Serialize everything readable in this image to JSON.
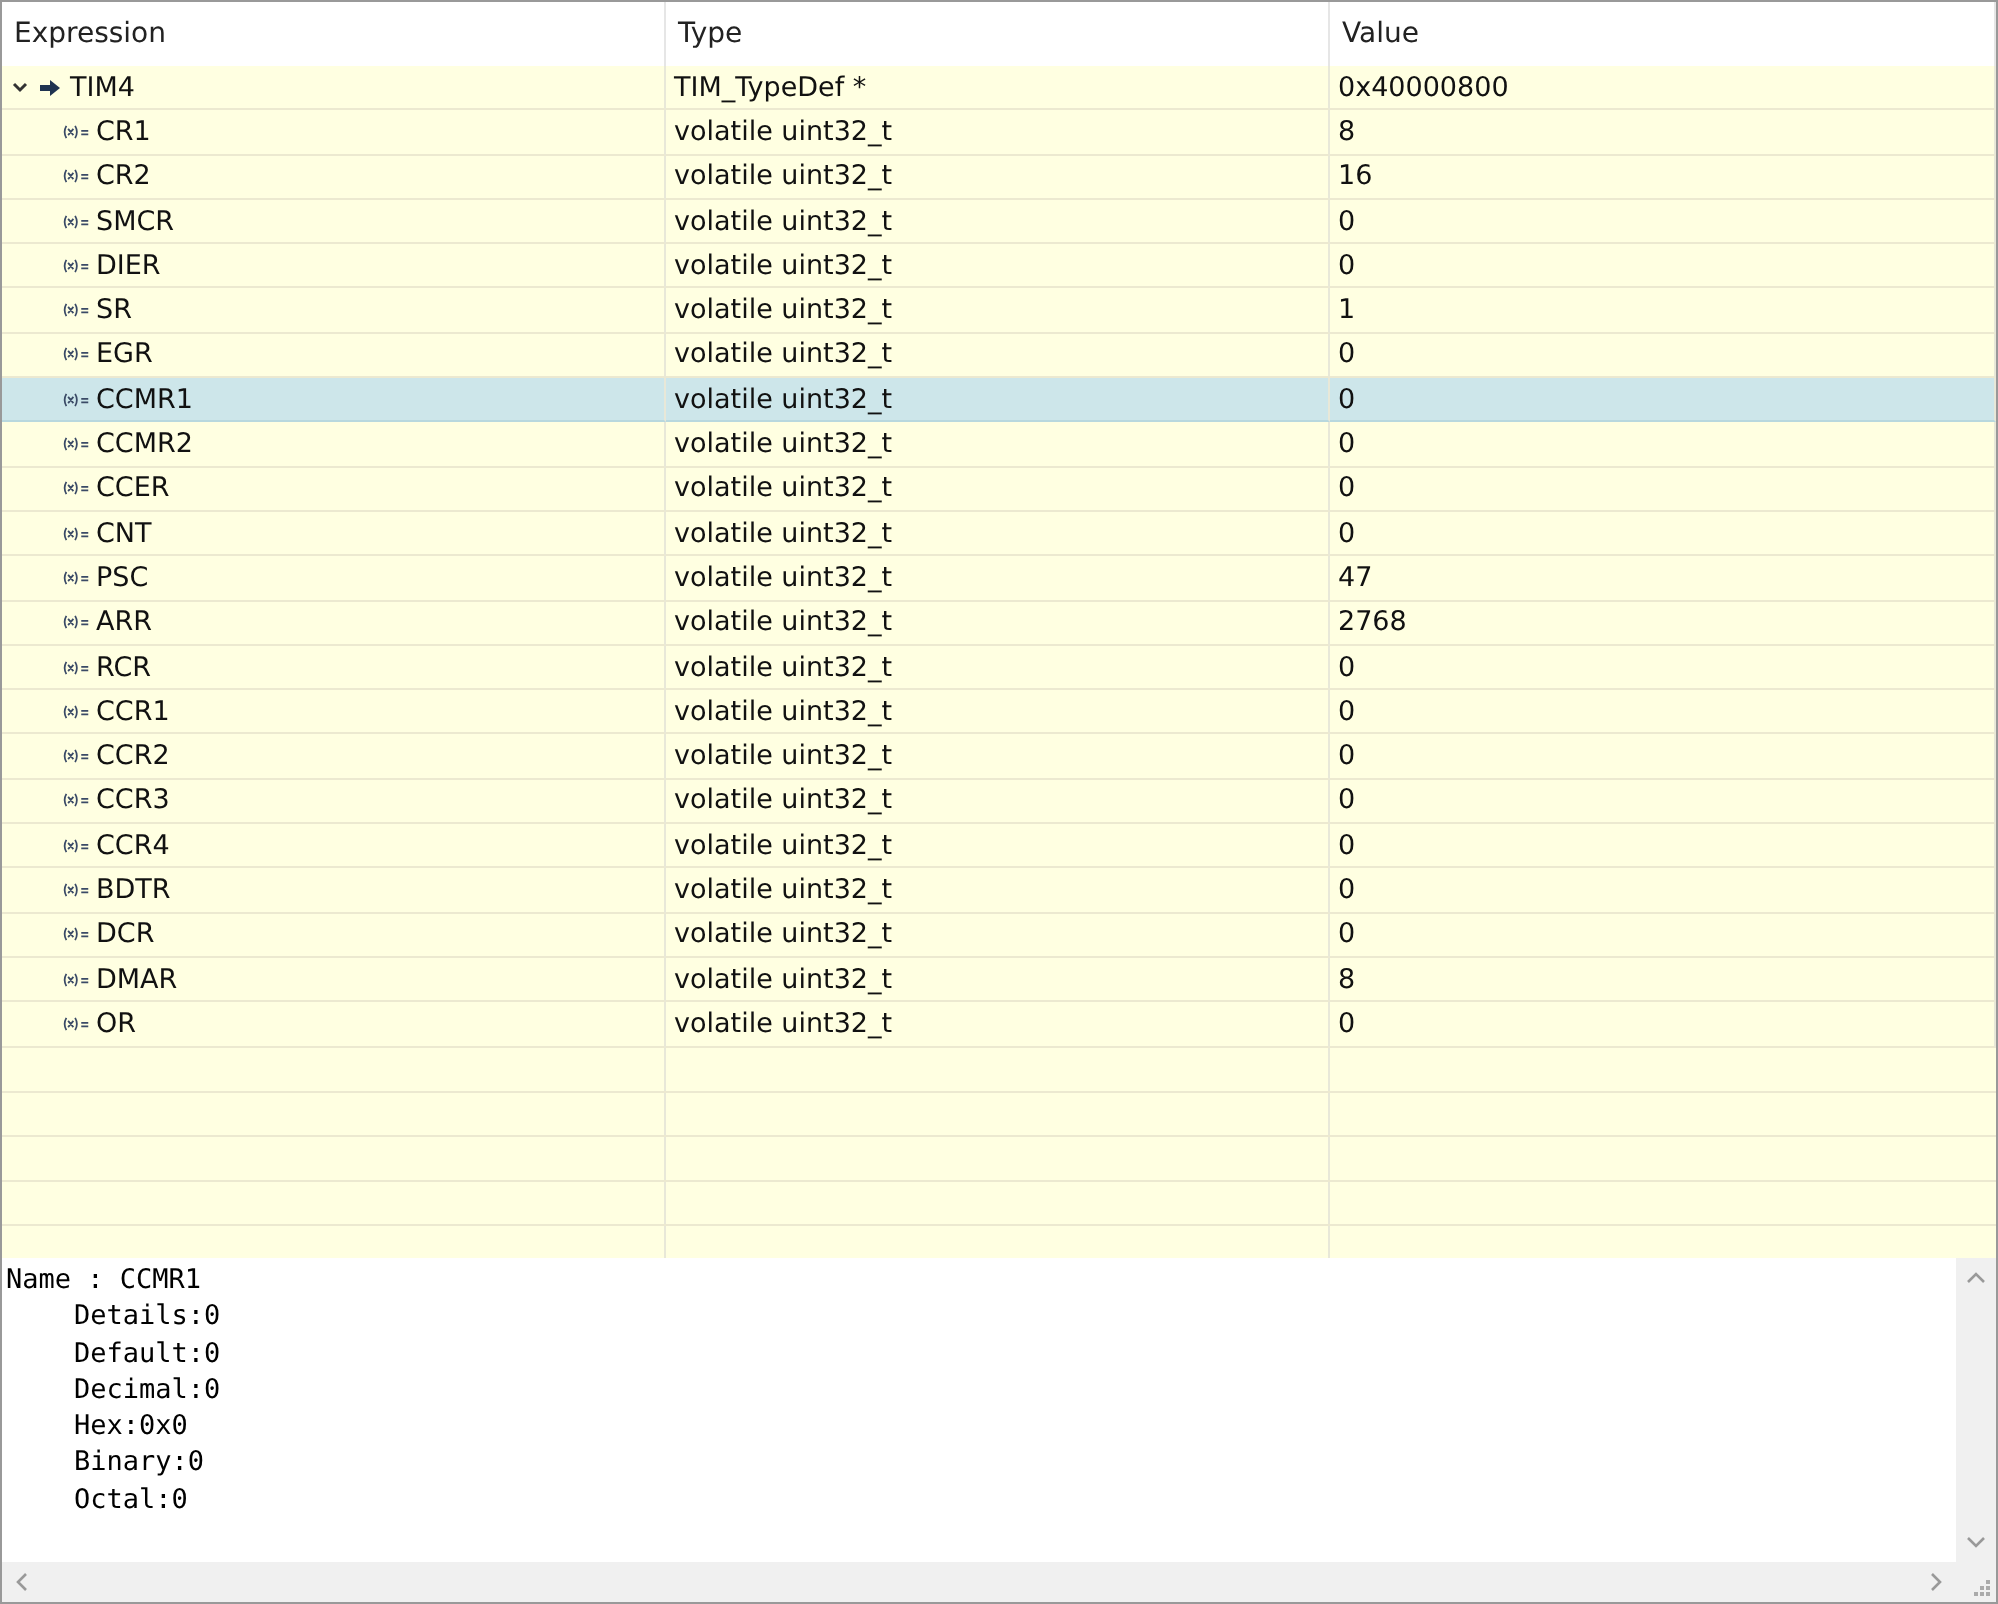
{
  "table": {
    "columns": [
      "Expression",
      "Type",
      "Value"
    ],
    "rows": [
      {
        "expression": "TIM4",
        "type": "TIM_TypeDef *",
        "value": "0x40000800",
        "kind": "pointer",
        "expanded": true,
        "selected": false,
        "children": [
          {
            "expression": "CR1",
            "type": "volatile uint32_t",
            "value": "8",
            "kind": "variable",
            "selected": false
          },
          {
            "expression": "CR2",
            "type": "volatile uint32_t",
            "value": "16",
            "kind": "variable",
            "selected": false
          },
          {
            "expression": "SMCR",
            "type": "volatile uint32_t",
            "value": "0",
            "kind": "variable",
            "selected": false
          },
          {
            "expression": "DIER",
            "type": "volatile uint32_t",
            "value": "0",
            "kind": "variable",
            "selected": false
          },
          {
            "expression": "SR",
            "type": "volatile uint32_t",
            "value": "1",
            "kind": "variable",
            "selected": false
          },
          {
            "expression": "EGR",
            "type": "volatile uint32_t",
            "value": "0",
            "kind": "variable",
            "selected": false
          },
          {
            "expression": "CCMR1",
            "type": "volatile uint32_t",
            "value": "0",
            "kind": "variable",
            "selected": true
          },
          {
            "expression": "CCMR2",
            "type": "volatile uint32_t",
            "value": "0",
            "kind": "variable",
            "selected": false
          },
          {
            "expression": "CCER",
            "type": "volatile uint32_t",
            "value": "0",
            "kind": "variable",
            "selected": false
          },
          {
            "expression": "CNT",
            "type": "volatile uint32_t",
            "value": "0",
            "kind": "variable",
            "selected": false
          },
          {
            "expression": "PSC",
            "type": "volatile uint32_t",
            "value": "47",
            "kind": "variable",
            "selected": false
          },
          {
            "expression": "ARR",
            "type": "volatile uint32_t",
            "value": "2768",
            "kind": "variable",
            "selected": false
          },
          {
            "expression": "RCR",
            "type": "volatile uint32_t",
            "value": "0",
            "kind": "variable",
            "selected": false
          },
          {
            "expression": "CCR1",
            "type": "volatile uint32_t",
            "value": "0",
            "kind": "variable",
            "selected": false
          },
          {
            "expression": "CCR2",
            "type": "volatile uint32_t",
            "value": "0",
            "kind": "variable",
            "selected": false
          },
          {
            "expression": "CCR3",
            "type": "volatile uint32_t",
            "value": "0",
            "kind": "variable",
            "selected": false
          },
          {
            "expression": "CCR4",
            "type": "volatile uint32_t",
            "value": "0",
            "kind": "variable",
            "selected": false
          },
          {
            "expression": "BDTR",
            "type": "volatile uint32_t",
            "value": "0",
            "kind": "variable",
            "selected": false
          },
          {
            "expression": "DCR",
            "type": "volatile uint32_t",
            "value": "0",
            "kind": "variable",
            "selected": false
          },
          {
            "expression": "DMAR",
            "type": "volatile uint32_t",
            "value": "8",
            "kind": "variable",
            "selected": false
          },
          {
            "expression": "OR",
            "type": "volatile uint32_t",
            "value": "0",
            "kind": "variable",
            "selected": false
          }
        ]
      }
    ]
  },
  "details": {
    "heading": "Name : CCMR1",
    "lines": [
      "Details:0",
      "Default:0",
      "Decimal:0",
      "Hex:0x0",
      "Binary:0",
      "Octal:0"
    ]
  }
}
